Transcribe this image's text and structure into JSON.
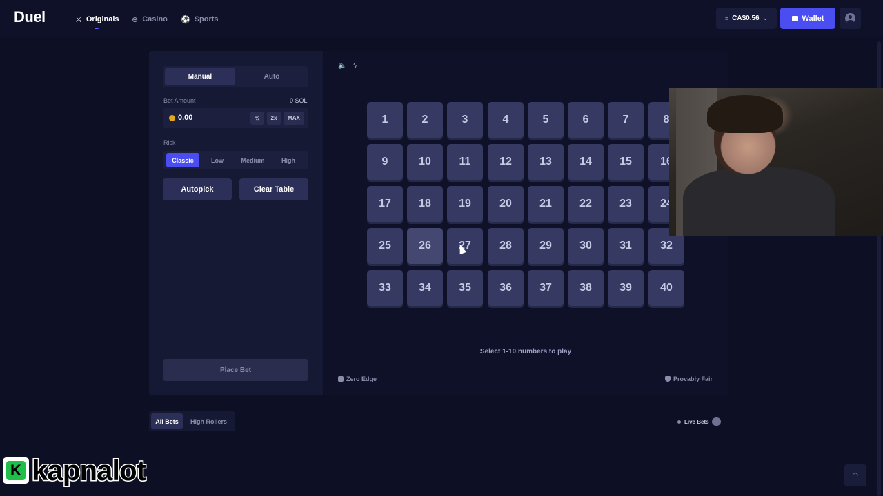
{
  "header": {
    "logo": "Duel",
    "nav": [
      {
        "label": "Originals",
        "icon": "crossed-swords-icon",
        "active": true
      },
      {
        "label": "Casino",
        "icon": "chip-icon",
        "active": false
      },
      {
        "label": "Sports",
        "icon": "ball-icon",
        "active": false
      }
    ],
    "balance": "CA$0.56",
    "wallet_label": "Wallet"
  },
  "left": {
    "modes": [
      "Manual",
      "Auto"
    ],
    "bet_amount_label": "Bet Amount",
    "bet_amount_currency": "0 SOL",
    "bet_value": "0.00",
    "bet_buttons": [
      "½",
      "2x",
      "MAX"
    ],
    "risk_label": "Risk",
    "risk_options": [
      "Classic",
      "Low",
      "Medium",
      "High"
    ],
    "autopick_label": "Autopick",
    "clear_label": "Clear Table",
    "place_bet_label": "Place Bet"
  },
  "game": {
    "tiles": [
      "1",
      "2",
      "3",
      "4",
      "5",
      "6",
      "7",
      "8",
      "9",
      "10",
      "11",
      "12",
      "13",
      "14",
      "15",
      "16",
      "17",
      "18",
      "19",
      "20",
      "21",
      "22",
      "23",
      "24",
      "25",
      "26",
      "27",
      "28",
      "29",
      "30",
      "31",
      "32",
      "33",
      "34",
      "35",
      "36",
      "37",
      "38",
      "39",
      "40"
    ],
    "hint": "Select 1-10 numbers to play",
    "zero_edge_label": "Zero Edge",
    "provably_fair_label": "Provably Fair"
  },
  "bets": {
    "tabs": [
      "All Bets",
      "High Rollers"
    ],
    "live_label": "Live Bets"
  },
  "watermark": "kapnalot",
  "colors": {
    "accent": "#4a4ef0",
    "background": "#0d0f24",
    "panel": "#161934",
    "tile": "#363a62"
  }
}
